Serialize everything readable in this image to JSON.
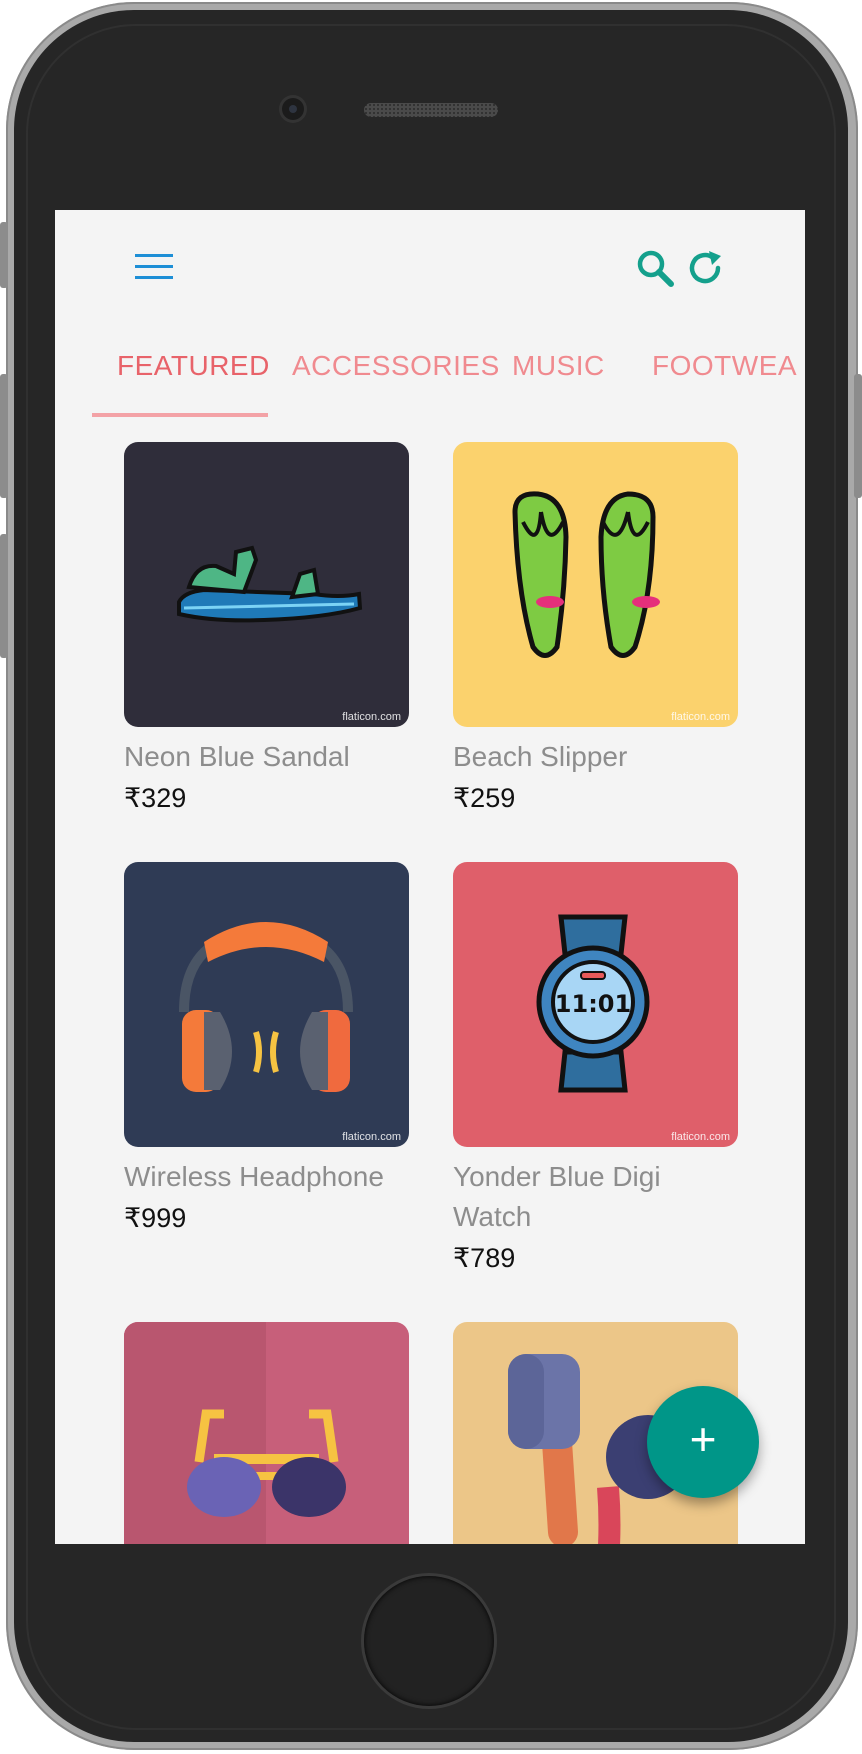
{
  "toolbar": {
    "menu_icon": "hamburger-menu-icon",
    "search_icon": "search-icon",
    "refresh_icon": "refresh-icon",
    "accent_color": "#1e8fd6",
    "action_color": "#14a08c"
  },
  "tabs": [
    {
      "label": "FEATURED",
      "active": true
    },
    {
      "label": "ACCESSORIES",
      "active": false
    },
    {
      "label": "MUSIC",
      "active": false
    },
    {
      "label": "FOOTWEA",
      "active": false
    }
  ],
  "products": [
    {
      "name": "Neon Blue Sandal",
      "price": "₹329",
      "image": "sandal-icon",
      "bg": "#2f2d3a",
      "credit": "flaticon.com"
    },
    {
      "name": "Beach Slipper",
      "price": "₹259",
      "image": "flip-flops-icon",
      "bg": "#fbd26d",
      "credit": "flaticon.com"
    },
    {
      "name": "Wireless Headphone",
      "price": "₹999",
      "image": "headphones-icon",
      "bg": "#2f3b55",
      "credit": "flaticon.com"
    },
    {
      "name": "Yonder Blue Digi Watch",
      "price": "₹789",
      "image": "smartwatch-icon",
      "bg": "#df5f6a",
      "watch_time": "11:01",
      "credit": "flaticon.com"
    },
    {
      "name": "",
      "price": "",
      "image": "sunglasses-icon",
      "bg": "#c75f7a"
    },
    {
      "name": "",
      "price": "",
      "image": "earphones-icon",
      "bg": "#ecc688"
    }
  ],
  "fab": {
    "label": "+",
    "color": "#009688"
  }
}
